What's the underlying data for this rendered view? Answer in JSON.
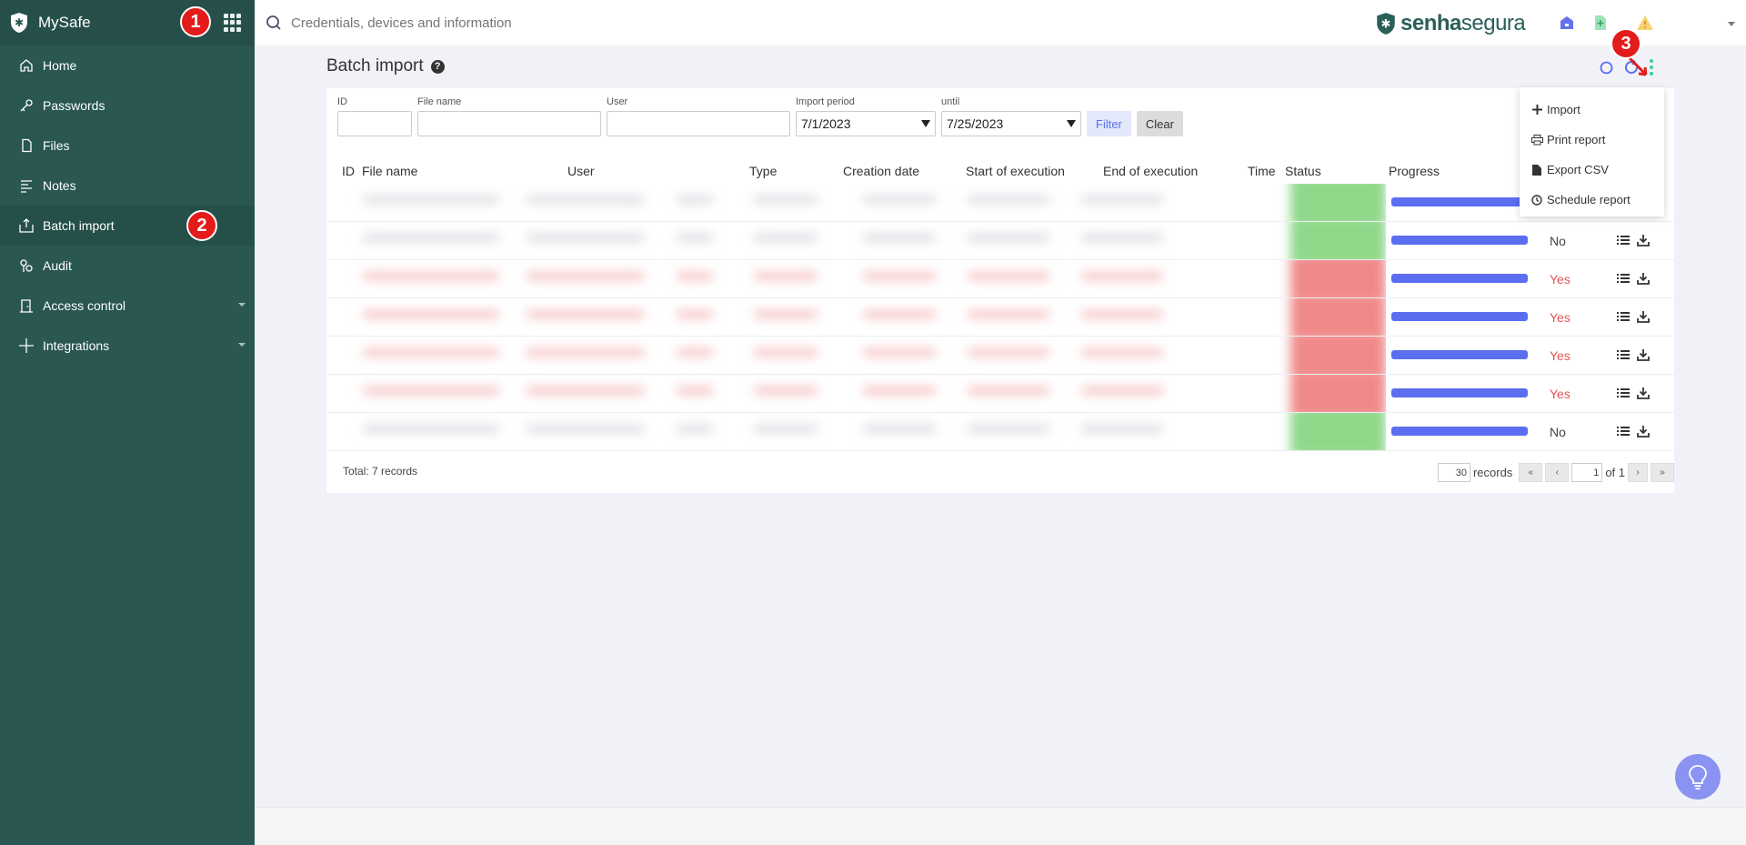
{
  "sidebar": {
    "app_name": "MySafe",
    "items": [
      {
        "label": "Home"
      },
      {
        "label": "Passwords"
      },
      {
        "label": "Files"
      },
      {
        "label": "Notes"
      },
      {
        "label": "Batch import"
      },
      {
        "label": "Audit"
      },
      {
        "label": "Access control"
      },
      {
        "label": "Integrations"
      }
    ]
  },
  "topbar": {
    "search_placeholder": "Credentials, devices and information",
    "brand_bold": "senha",
    "brand_rest": "segura"
  },
  "page": {
    "title": "Batch import",
    "help": "?"
  },
  "filters": {
    "id_label": "ID",
    "file_label": "File name",
    "user_label": "User",
    "period_label": "Import period",
    "period_from": "7/1/2023",
    "until_label": "until",
    "period_to": "7/25/2023",
    "filter_btn": "Filter",
    "clear_btn": "Clear"
  },
  "table": {
    "headers": {
      "id": "ID",
      "file": "File name",
      "user": "User",
      "type": "Type",
      "created": "Creation date",
      "start": "Start of execution",
      "end": "End of execution",
      "time": "Time",
      "status": "Status",
      "progress": "Progress"
    },
    "rows": [
      {
        "progress": 1.0,
        "errors": "",
        "status": "success"
      },
      {
        "progress": 1.0,
        "errors": "No",
        "status": "success"
      },
      {
        "progress": 1.0,
        "errors": "Yes",
        "status": "error"
      },
      {
        "progress": 1.0,
        "errors": "Yes",
        "status": "error"
      },
      {
        "progress": 1.0,
        "errors": "Yes",
        "status": "error"
      },
      {
        "progress": 1.0,
        "errors": "Yes",
        "status": "error"
      },
      {
        "progress": 1.0,
        "errors": "No",
        "status": "success"
      }
    ]
  },
  "footer": {
    "total": "Total: 7 records",
    "per_page": "30",
    "records_label": "records",
    "page": "1",
    "of_label": "of 1",
    "first": "«",
    "prev": "‹",
    "next": "›",
    "last": "»"
  },
  "menu": {
    "items": [
      {
        "label": "Import",
        "icon": "plus-icon"
      },
      {
        "label": "Print report",
        "icon": "printer-icon"
      },
      {
        "label": "Export CSV",
        "icon": "file-icon"
      },
      {
        "label": "Schedule report",
        "icon": "clock-icon"
      }
    ]
  },
  "annotations": [
    "1",
    "2",
    "3"
  ],
  "colors": {
    "sidebar": "#2a5752",
    "accent": "#5b6ef0",
    "error": "#e05555",
    "success_status": "#8fd88a",
    "error_status": "#f08a8a"
  }
}
